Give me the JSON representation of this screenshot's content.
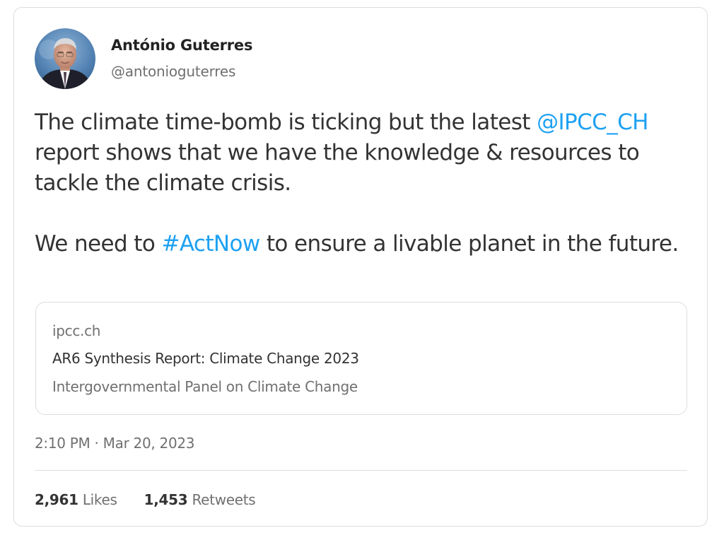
{
  "author": {
    "name": "António Guterres",
    "handle": "@antonioguterres",
    "avatar_icon": "person-portrait-icon"
  },
  "tweet": {
    "line1_before": "The climate time-bomb is ticking but the latest ",
    "mention": "@IPCC_CH",
    "line1_after": " report shows that we have the knowledge & resources to tackle the climate crisis.",
    "para2_before": "We need to ",
    "hashtag": "#ActNow",
    "para2_after": " to ensure a livable planet in the future."
  },
  "link_card": {
    "domain": "ipcc.ch",
    "title": "AR6 Synthesis Report: Climate Change 2023",
    "description": "Intergovernmental Panel on Climate Change"
  },
  "timestamp": "2:10 PM · Mar 20, 2023",
  "stats": {
    "likes_count": "2,961",
    "likes_label": "Likes",
    "retweets_count": "1,453",
    "retweets_label": "Retweets"
  },
  "colors": {
    "accent": "#1da1f2",
    "text": "#333333",
    "muted": "#707070",
    "border": "#dddddd"
  }
}
